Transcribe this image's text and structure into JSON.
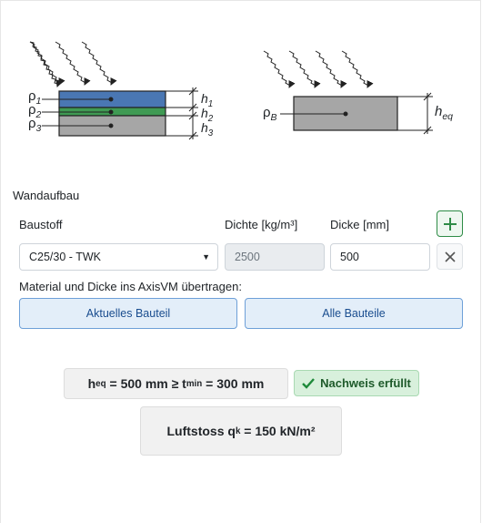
{
  "diagram": {
    "left_labels": [
      "ρ",
      "ρ",
      "ρ"
    ],
    "left_label_subs": [
      "1",
      "2",
      "3"
    ],
    "right_thickness_labels": [
      "h",
      "h",
      "h"
    ],
    "right_thickness_subs": [
      "1",
      "2",
      "3"
    ],
    "equiv_density": "ρ",
    "equiv_density_sub": "B",
    "equiv_thickness": "h",
    "equiv_thickness_sub": "eq",
    "layer_colors": [
      "#4a77b3",
      "#3f9a53",
      "#a6a6a6"
    ]
  },
  "wall": {
    "section_title": "Wandaufbau",
    "col_material": "Baustoff",
    "col_density": "Dichte [kg/m³]",
    "col_thickness": "Dicke [mm]",
    "material_value": "C25/30 - TWK",
    "density_value": "2500",
    "thickness_value": "500",
    "add_icon": "plus-icon",
    "remove_icon": "close-icon"
  },
  "transfer": {
    "label": "Material und Dicke ins AxisVM übertragen:",
    "current_button": "Aktuelles Bauteil",
    "all_button": "Alle Bauteile"
  },
  "result": {
    "h": "h",
    "h_sub": "eq",
    "h_text": " = 500 mm ≥ ",
    "t": "t",
    "t_sub": "min",
    "t_text": " = 300 mm",
    "status_icon": "check-icon",
    "status_text": "Nachweis erfüllt",
    "q_prefix": "Luftstoss q",
    "q_sub": "k",
    "q_text": " = 150 kN/m²"
  },
  "colors": {
    "accent_green": "#2e8b46",
    "button_blue": "#e3eef9"
  }
}
